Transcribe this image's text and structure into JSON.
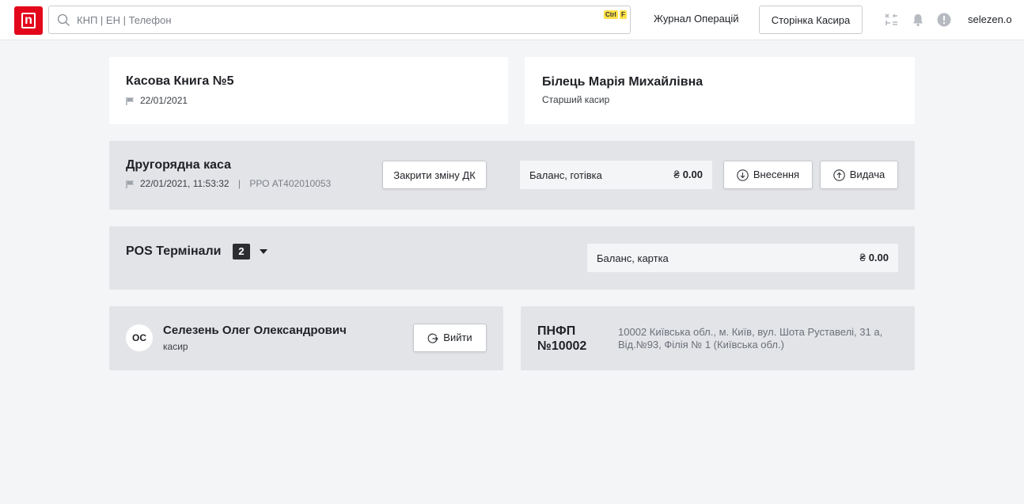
{
  "header": {
    "logo_letter": "n",
    "search_placeholder": "КНП | ЕН | Телефон",
    "shortcut_ctrl": "Ctrl",
    "shortcut_key": "F",
    "journal_link": "Журнал Операцій",
    "cashier_page_button": "Сторінка Касира",
    "username": "selezen.o"
  },
  "cash_book": {
    "title": "Касова Книга №5",
    "date": "22/01/2021"
  },
  "senior_cashier": {
    "name": "Білець Марія Михайлівна",
    "role": "Старший касир"
  },
  "secondary_register": {
    "title": "Другорядна каса",
    "datetime": "22/01/2021, 11:53:32",
    "separator": "|",
    "rro": "РРО АТ402010053",
    "close_shift_button": "Закрити зміну ДК",
    "balance_label": "Баланс, готівка",
    "currency": "₴",
    "balance_value": "0.00",
    "deposit_button": "Внесення",
    "withdraw_button": "Видача"
  },
  "pos": {
    "title": "POS Термінали",
    "count": "2",
    "balance_label": "Баланс, картка",
    "currency": "₴",
    "balance_value": "0.00"
  },
  "cashier": {
    "initials": "ОС",
    "name": "Селезень Олег Олександрович",
    "role": "касир",
    "logout_button": "Вийти"
  },
  "branch": {
    "title": "ПНФП №10002",
    "address": "10002 Київська обл., м. Київ, вул. Шота Руставелі, 31 а, Від.№93, Філія № 1 (Київська обл.)"
  },
  "colors": {
    "brand": "#e3071b",
    "background": "#f4f5f7",
    "card_grey": "#e3e4e8",
    "shortcut_badge": "#fde047"
  }
}
